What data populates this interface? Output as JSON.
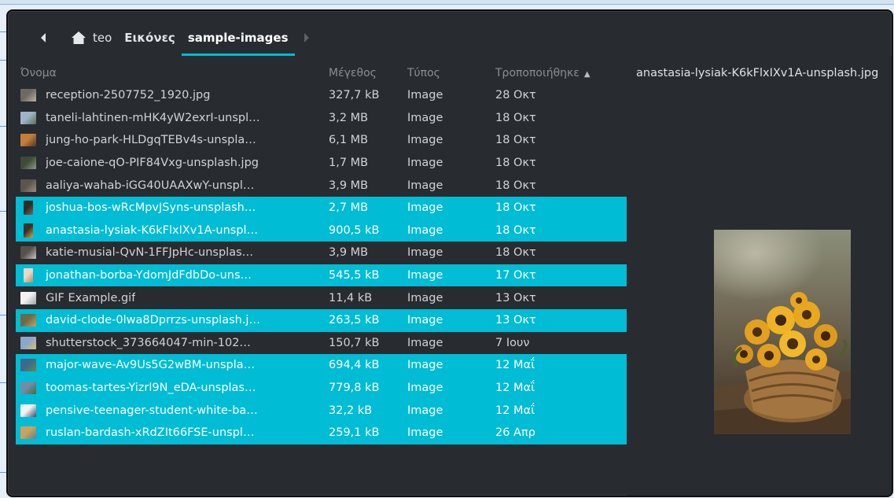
{
  "pathbar": {
    "crumbs": [
      "teo",
      "Εικόνες",
      "sample-images"
    ]
  },
  "list": {
    "headers": {
      "name": "Όνομα",
      "size": "Μέγεθος",
      "type": "Τύπος",
      "modified": "Τροποποιήθηκε"
    },
    "rows": [
      {
        "name": "reception-2507752_1920.jpg",
        "size": "327,7 kB",
        "type": "Image",
        "modified": "28 Οκτ",
        "selected": false,
        "thumb": [
          "#6e6a63",
          "#b8b2a6"
        ],
        "portrait": false
      },
      {
        "name": "taneli-lahtinen-mHK4yW2exrI-unspl…",
        "size": "3,2 MB",
        "type": "Image",
        "modified": "18 Οκτ",
        "selected": false,
        "thumb": [
          "#9db4c8",
          "#5a6e58"
        ],
        "portrait": false
      },
      {
        "name": "jung-ho-park-HLDgqTEBv4s-unspla…",
        "size": "6,1 MB",
        "type": "Image",
        "modified": "18 Οκτ",
        "selected": false,
        "thumb": [
          "#c77d3a",
          "#4a3b2a"
        ],
        "portrait": false
      },
      {
        "name": "joe-caione-qO-PIF84Vxg-unsplash.jpg",
        "size": "1,7 MB",
        "type": "Image",
        "modified": "18 Οκτ",
        "selected": false,
        "thumb": [
          "#3f4a3a",
          "#8f9a86"
        ],
        "portrait": false
      },
      {
        "name": "aaliya-wahab-iGG40UAAXwY-unspl…",
        "size": "3,9 MB",
        "type": "Image",
        "modified": "18 Οκτ",
        "selected": false,
        "thumb": [
          "#5b554c",
          "#9b8f7e"
        ],
        "portrait": false
      },
      {
        "name": "joshua-bos-wRcMpvJSyns-unsplash…",
        "size": "2,7 MB",
        "type": "Image",
        "modified": "18 Οκτ",
        "selected": true,
        "thumb": [
          "#2e2a26",
          "#7a6a55"
        ],
        "portrait": true
      },
      {
        "name": "anastasia-lysiak-K6kFlxIXv1A-unspl…",
        "size": "900,5 kB",
        "type": "Image",
        "modified": "18 Οκτ",
        "selected": true,
        "thumb": [
          "#3a3228",
          "#d9a13a"
        ],
        "portrait": true
      },
      {
        "name": "katie-musial-QvN-1FFJpHc-unsplas…",
        "size": "3,9 MB",
        "type": "Image",
        "modified": "18 Οκτ",
        "selected": false,
        "thumb": [
          "#55514b",
          "#c9c4bb"
        ],
        "portrait": false
      },
      {
        "name": "jonathan-borba-YdomJdFdbDo-uns…",
        "size": "545,5 kB",
        "type": "Image",
        "modified": "17 Οκτ",
        "selected": true,
        "thumb": [
          "#e7d8c3",
          "#b88a5d"
        ],
        "portrait": true
      },
      {
        "name": "GIF Example.gif",
        "size": "11,4 kB",
        "type": "Image",
        "modified": "13 Οκτ",
        "selected": false,
        "thumb": [
          "#f1f1f1",
          "#9aa4ad"
        ],
        "portrait": false
      },
      {
        "name": "david-clode-0lwa8Dprrzs-unsplash.j…",
        "size": "263,5 kB",
        "type": "Image",
        "modified": "13 Οκτ",
        "selected": true,
        "thumb": [
          "#6b6b4a",
          "#caa35a"
        ],
        "portrait": false
      },
      {
        "name": "shutterstock_373664047-min-102…",
        "size": "150,7 kB",
        "type": "Image",
        "modified": "7 Ιουν",
        "selected": false,
        "thumb": [
          "#8aa6c9",
          "#d5c07a"
        ],
        "portrait": false
      },
      {
        "name": "major-wave-Av9Us5G2wBM-unspla…",
        "size": "694,4 kB",
        "type": "Image",
        "modified": "12 Μαΐ",
        "selected": true,
        "thumb": [
          "#3d6a8a",
          "#5f8a4e"
        ],
        "portrait": false
      },
      {
        "name": "toomas-tartes-Yizrl9N_eDA-unsplas…",
        "size": "779,8 kB",
        "type": "Image",
        "modified": "12 Μαΐ",
        "selected": true,
        "thumb": [
          "#6e8fa8",
          "#4a6a3a"
        ],
        "portrait": false
      },
      {
        "name": "pensive-teenager-student-white-ba…",
        "size": "32,2 kB",
        "type": "Image",
        "modified": "12 Μαΐ",
        "selected": true,
        "thumb": [
          "#f3f3f3",
          "#3a4a6a"
        ],
        "portrait": false
      },
      {
        "name": "ruslan-bardash-xRdZIt66FSE-unspl…",
        "size": "259,1 kB",
        "type": "Image",
        "modified": "26 Απρ",
        "selected": true,
        "thumb": [
          "#caa35a",
          "#5d7f9b"
        ],
        "portrait": false
      }
    ]
  },
  "preview": {
    "title": "anastasia-lysiak-K6kFlxIXv1A-unsplash.jpg"
  },
  "colors": {
    "accent": "#00bcd4",
    "window_bg": "#282b30"
  }
}
